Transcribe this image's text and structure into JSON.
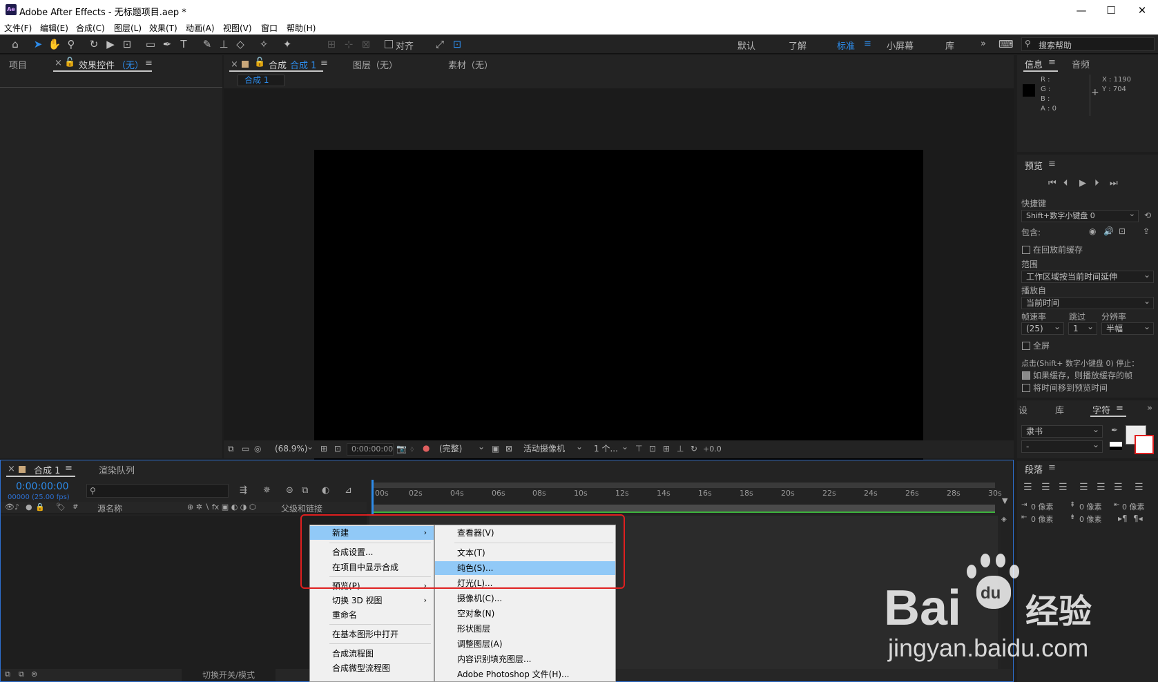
{
  "window": {
    "title": "Adobe After Effects - 无标题项目.aep *",
    "app_icon": "Ae",
    "controls": [
      "—",
      "☐",
      "✕"
    ]
  },
  "menubar": [
    "文件(F)",
    "编辑(E)",
    "合成(C)",
    "图层(L)",
    "效果(T)",
    "动画(A)",
    "视图(V)",
    "窗口",
    "帮助(H)"
  ],
  "toolbar": {
    "align_label": "对齐",
    "workspaces": [
      "默认",
      "了解",
      "标准",
      "小屏幕",
      "库"
    ],
    "active_workspace": "标准",
    "search_placeholder": "搜索帮助",
    "more": "»"
  },
  "project_panel": {
    "tab_project": "项目",
    "tab_effects": "效果控件",
    "effects_suffix": "（无）"
  },
  "comp_panel": {
    "tab_comp": "合成",
    "comp_name": "合成 1",
    "tab_layer": "图层（无）",
    "tab_footage": "素材（无）",
    "breadcrumb": "合成 1"
  },
  "viewer_footer": {
    "zoom": "(68.9%)",
    "time": "0:00:00:00",
    "resolution": "(完整)",
    "camera": "活动摄像机",
    "views": "1 个...",
    "exposure": "+0.0"
  },
  "info_panel": {
    "tab_info": "信息",
    "tab_audio": "音频",
    "r": "R :",
    "g": "G :",
    "b": "B :",
    "a": "A : 0",
    "x": "X : 1190",
    "y": "Y : 704"
  },
  "preview_panel": {
    "title": "预览",
    "shortcut_label": "快捷键",
    "shortcut_value": "Shift+数字小键盘 0",
    "include_label": "包含:",
    "cache_before": "在回放前缓存",
    "range_label": "范围",
    "range_value": "工作区域按当前时间延伸",
    "play_from_label": "播放自",
    "play_from_value": "当前时间",
    "fps_label": "帧速率",
    "skip_label": "跳过",
    "res_label": "分辨率",
    "fps_value": "(25)",
    "skip_value": "1",
    "res_value": "半幅",
    "fullscreen": "全屏",
    "stop_hint": "点击(Shift+ 数字小键盘 0) 停止：",
    "if_cached": "如果缓存，则播放缓存的帧",
    "move_time": "将时间移到预览时间"
  },
  "char_panel": {
    "tab_settings": "设",
    "tab_lib": "库",
    "tab_char": "字符",
    "font": "隶书",
    "style": "-"
  },
  "para_panel": {
    "title": "段落",
    "indent1": "0 像素",
    "indent2": "0 像素",
    "indent3": "0 像素",
    "space1": "0 像素",
    "space2": "0 像素"
  },
  "timeline": {
    "tab_comp": "合成 1",
    "tab_render": "渲染队列",
    "timecode": "0:00:00:00",
    "fps_info": "00000 (25.00 fps)",
    "col_source": "源名称",
    "col_parent": "父级和链接",
    "switch_label": "切换开关/模式",
    "ruler": [
      "00s",
      "02s",
      "04s",
      "06s",
      "08s",
      "10s",
      "12s",
      "14s",
      "16s",
      "18s",
      "20s",
      "22s",
      "24s",
      "26s",
      "28s",
      "30s"
    ]
  },
  "context_menu": {
    "left": [
      {
        "label": "新建",
        "submenu": true,
        "highlighted": true
      },
      {
        "label": "合成设置..."
      },
      {
        "label": "在项目中显示合成"
      },
      {
        "label": "预览(P)",
        "submenu": true
      },
      {
        "label": "切换 3D 视图",
        "submenu": true
      },
      {
        "label": "重命名"
      },
      {
        "label": "在基本图形中打开"
      },
      {
        "label": "合成流程图"
      },
      {
        "label": "合成微型流程图"
      }
    ],
    "right": [
      {
        "label": "查看器(V)"
      },
      {
        "label": "文本(T)"
      },
      {
        "label": "纯色(S)...",
        "highlighted": true
      },
      {
        "label": "灯光(L)..."
      },
      {
        "label": "摄像机(C)..."
      },
      {
        "label": "空对象(N)"
      },
      {
        "label": "形状图层"
      },
      {
        "label": "调整图层(A)"
      },
      {
        "label": "内容识别填充图层..."
      },
      {
        "label": "Adobe Photoshop 文件(H)..."
      }
    ]
  },
  "watermark": {
    "brand": "Bai",
    "brand2": "du",
    "brand_cn": "经验",
    "url": "jingyan.baidu.com"
  },
  "colors": {
    "accent": "#2d8ceb",
    "highlight": "#91c9f7",
    "red_box": "#e02020"
  }
}
